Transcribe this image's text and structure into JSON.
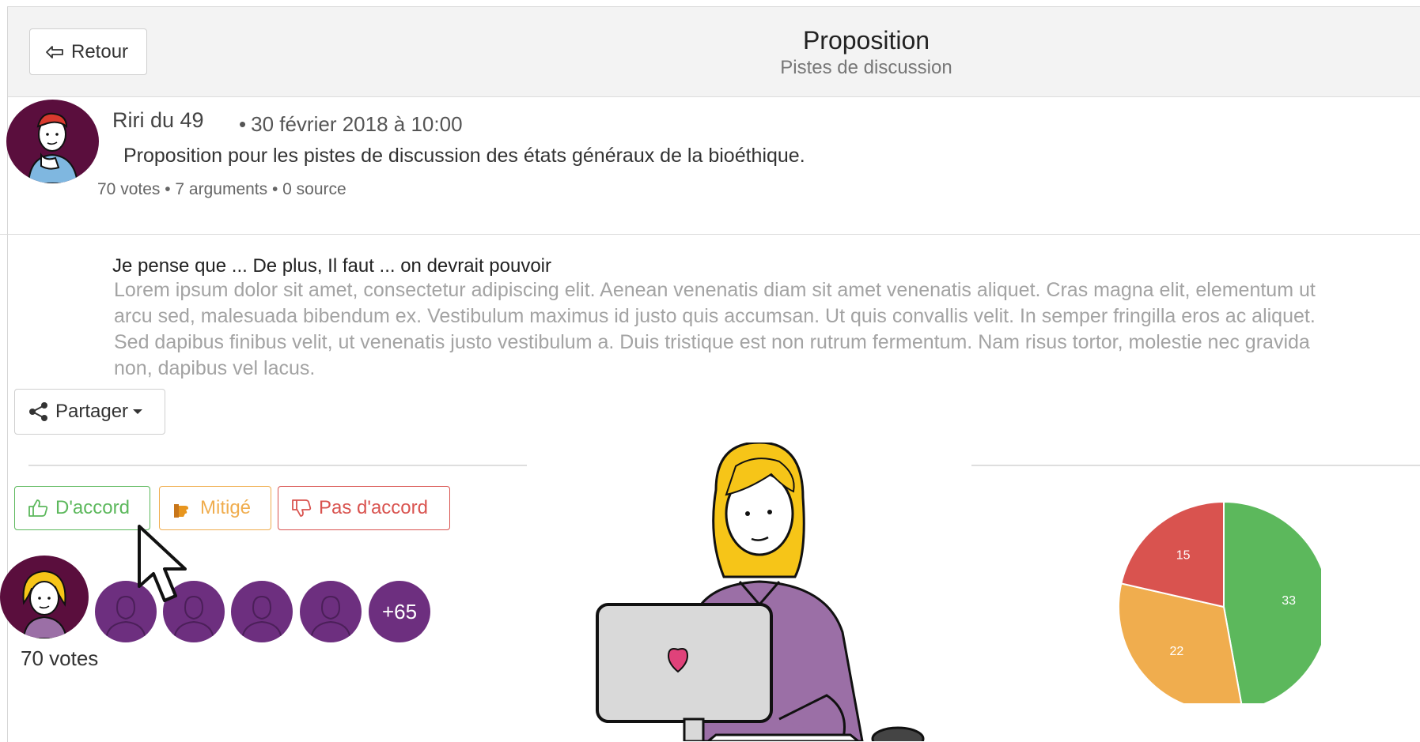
{
  "header": {
    "back_label": "Retour",
    "title": "Proposition",
    "subtitle": "Pistes de discussion"
  },
  "post": {
    "author": "Riri du 49",
    "date_bullet": "•",
    "date": "30 février 2018 à 10:00",
    "description": "Proposition pour les pistes de discussion des états généraux de la bioéthique.",
    "meta": "70 votes • 7 arguments • 0 source"
  },
  "body": {
    "lead": "Je pense que ... De plus, Il faut ... on devrait pouvoir",
    "lorem": "Lorem ipsum dolor sit amet, consectetur adipiscing elit. Aenean venenatis diam sit amet venenatis aliquet. Cras magna elit, elementum ut arcu sed, malesuada bibendum ex. Vestibulum maximus id justo quis accumsan. Ut quis convallis velit. In semper fringilla eros ac aliquet. Sed dapibus finibus velit, ut venenatis justo vestibulum a. Duis tristique est non rutrum fermentum. Nam risus tortor, molestie nec gravida non, dapibus vel lacus."
  },
  "share": {
    "label": "Partager"
  },
  "vote_buttons": {
    "agree": "D'accord",
    "mixed": "Mitigé",
    "disagree": "Pas d'accord"
  },
  "voters": {
    "more_label": "+65",
    "votes_label": "70 votes"
  },
  "colors": {
    "agree": "#5cb85c",
    "mixed": "#f0ad4e",
    "disagree": "#d9534f",
    "avatar": "#6d2f7f"
  },
  "icons": [
    "back-arrow-icon",
    "share-icon",
    "caret-down-icon",
    "thumbs-up-icon",
    "hand-icon",
    "thumbs-down-icon",
    "user-icon",
    "mouse-cursor-icon"
  ],
  "chart_data": {
    "type": "pie",
    "categories": [
      "D'accord",
      "Mitigé",
      "Pas d'accord"
    ],
    "values": [
      33,
      22,
      15
    ],
    "colors": [
      "#5cb85c",
      "#f0ad4e",
      "#d9534f"
    ]
  }
}
